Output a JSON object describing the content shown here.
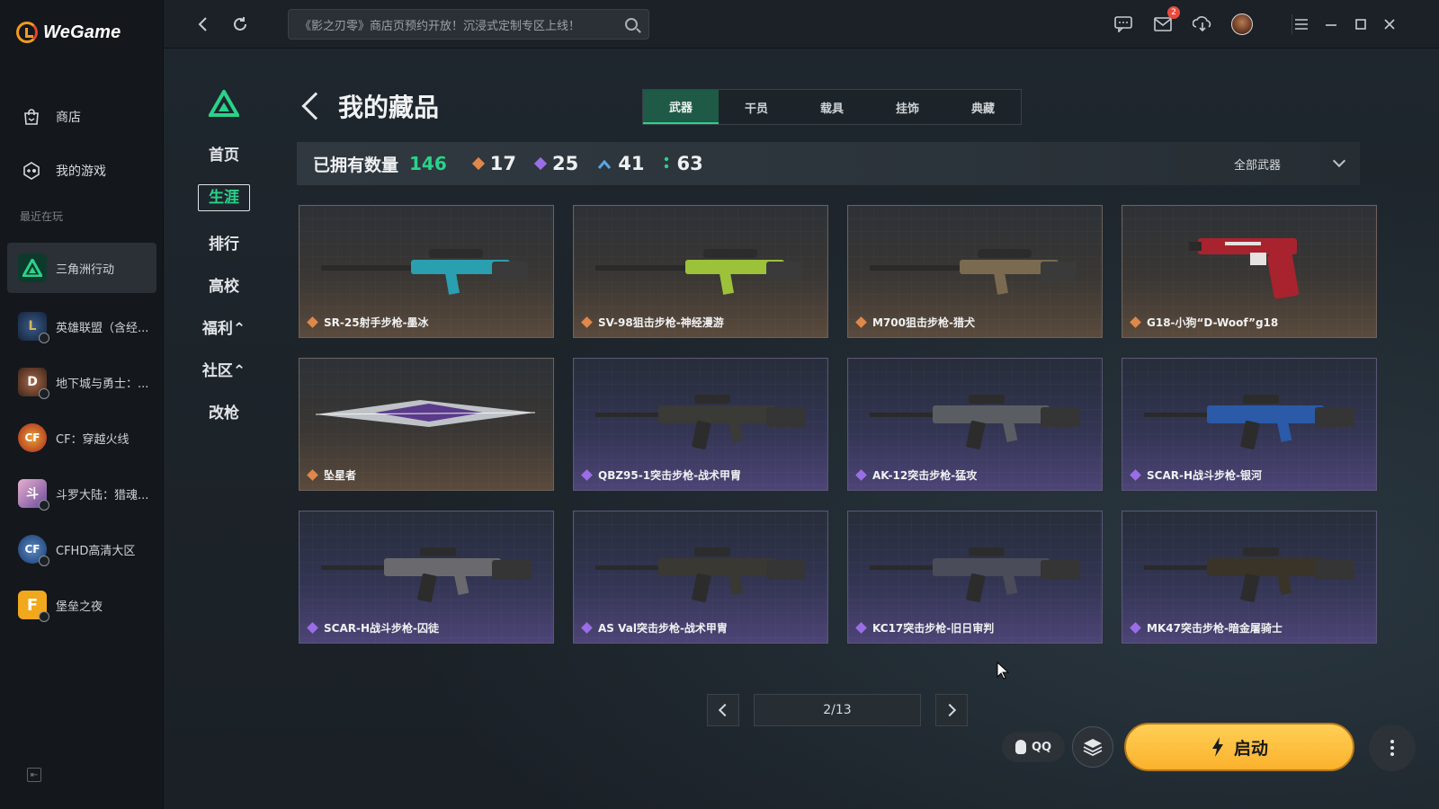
{
  "app": {
    "brand": "WeGame"
  },
  "sidebar": {
    "nav": [
      {
        "label": "商店",
        "icon": "store-bag-icon"
      },
      {
        "label": "我的游戏",
        "icon": "my-games-icon"
      }
    ],
    "recent_label": "最近在玩",
    "recent": [
      {
        "label": "三角洲行动",
        "color": "#0d3a2c",
        "glyph": "▲",
        "active": true
      },
      {
        "label": "英雄联盟（含经...",
        "color": "#1f3a5a",
        "glyph": "L"
      },
      {
        "label": "地下城与勇士：...",
        "color": "#5a3a2a",
        "glyph": "D"
      },
      {
        "label": "CF：穿越火线",
        "color": "#b8341f",
        "glyph": "CF"
      },
      {
        "label": "斗罗大陆：猎魂...",
        "color": "#b87aa8",
        "glyph": "斗"
      },
      {
        "label": "CFHD高清大区",
        "color": "#2a4d7a",
        "glyph": "CF"
      },
      {
        "label": "堡垒之夜",
        "color": "#f1a81d",
        "glyph": "F"
      }
    ]
  },
  "topbar": {
    "search_placeholder": "《影之刃零》商店页预约开放！沉浸式定制专区上线！",
    "mail_badge": "2"
  },
  "game_nav": {
    "items": [
      "首页",
      "生涯",
      "排行",
      "高校",
      "福利⌃",
      "社区⌃",
      "改枪"
    ],
    "active_index": 1
  },
  "page": {
    "title": "我的藏品",
    "tabs": [
      "武器",
      "干员",
      "载具",
      "挂饰",
      "典藏"
    ],
    "active_tab": 0
  },
  "stats": {
    "owned_label": "已拥有数量",
    "owned_total": "146",
    "tiers": [
      {
        "value": "17",
        "color": "#e0874a"
      },
      {
        "value": "25",
        "color": "#9b6ee6"
      },
      {
        "value": "41",
        "color": "#5aa6e8"
      },
      {
        "value": "63",
        "color": "#2ad28a"
      }
    ],
    "filter_label": "全部武器"
  },
  "items": [
    {
      "name": "SR-25射手步枪-墨冰",
      "rarity": "gold",
      "weapon": "sniper",
      "tint": "#2a9fb0"
    },
    {
      "name": "SV-98狙击步枪-神经漫游",
      "rarity": "gold",
      "weapon": "sniper",
      "tint": "#9cc23a"
    },
    {
      "name": "M700狙击步枪-猎犬",
      "rarity": "gold",
      "weapon": "sniper",
      "tint": "#7a6a50"
    },
    {
      "name": "G18-小狗“D-Woof”g18",
      "rarity": "gold",
      "weapon": "pistol",
      "tint": "#a8232e"
    },
    {
      "name": "坠星者",
      "rarity": "gold",
      "weapon": "blade",
      "tint": "#5a3a8a"
    },
    {
      "name": "QBZ95-1突击步枪-战术甲胄",
      "rarity": "purple",
      "weapon": "rifle",
      "tint": "#3a3a36"
    },
    {
      "name": "AK-12突击步枪-猛攻",
      "rarity": "purple",
      "weapon": "rifle",
      "tint": "#5a5e62"
    },
    {
      "name": "SCAR-H战斗步枪-银河",
      "rarity": "purple",
      "weapon": "rifle",
      "tint": "#2a5aa8"
    },
    {
      "name": "SCAR-H战斗步枪-囚徒",
      "rarity": "purple",
      "weapon": "rifle",
      "tint": "#6a6a6e"
    },
    {
      "name": "AS Val突击步枪-战术甲胄",
      "rarity": "purple",
      "weapon": "rifle",
      "tint": "#3a3832"
    },
    {
      "name": "KC17突击步枪-旧日审判",
      "rarity": "purple",
      "weapon": "rifle",
      "tint": "#4a4c5a"
    },
    {
      "name": "MK47突击步枪-暗金屠骑士",
      "rarity": "purple",
      "weapon": "rifle",
      "tint": "#3a3428"
    }
  ],
  "pagination": {
    "current": "2/13"
  },
  "actions": {
    "qq_label": "QQ",
    "launch_label": "启动"
  }
}
